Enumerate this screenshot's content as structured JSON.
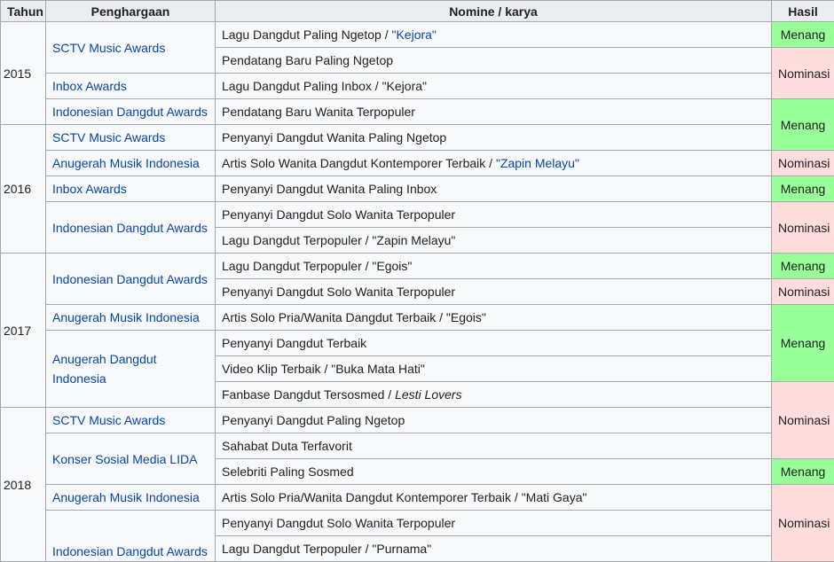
{
  "headers": {
    "year": "Tahun",
    "award": "Penghargaan",
    "nominee": "Nomine / karya",
    "result": "Hasil"
  },
  "colors": {
    "win": "#99ff99",
    "nominated": "#ffdddd",
    "link": "#0645ad",
    "header_bg": "#eaecf0",
    "border": "#a2a9b1"
  },
  "years": [
    "2015",
    "2016",
    "2017",
    "2018"
  ],
  "awards": {
    "sctv": "SCTV Music Awards",
    "inbox": "Inbox Awards",
    "ida": "Indonesian Dangdut Awards",
    "ami": "Anugerah Musik Indonesia",
    "adi": "Anugerah Dangdut Indonesia",
    "lida": "Konser Sosial Media LIDA"
  },
  "results": {
    "win": "Menang",
    "nom": "Nominasi"
  },
  "rows": {
    "r1": {
      "category": "Lagu Dangdut Paling Ngetop",
      "work": "\"Kejora\""
    },
    "r2": {
      "category": "Pendatang Baru Paling Ngetop"
    },
    "r3": {
      "category": "Lagu Dangdut Paling Inbox / \"Kejora\""
    },
    "r4": {
      "category": "Pendatang Baru Wanita Terpopuler"
    },
    "r5": {
      "category": "Penyanyi Dangdut Wanita Paling Ngetop"
    },
    "r6": {
      "category": "Artis Solo Wanita Dangdut Kontemporer Terbaik",
      "work": "\"Zapin Melayu\""
    },
    "r7": {
      "category": "Penyanyi Dangdut Wanita Paling Inbox"
    },
    "r8": {
      "category": "Penyanyi Dangdut Solo Wanita Terpopuler"
    },
    "r9": {
      "category": "Lagu Dangdut Terpopuler / \"Zapin Melayu\""
    },
    "r10": {
      "category": "Lagu Dangdut Terpopuler / \"Egois\""
    },
    "r11": {
      "category": "Penyanyi Dangdut Solo Wanita Terpopuler"
    },
    "r12": {
      "category": "Artis Solo Pria/Wanita Dangdut Terbaik / \"Egois\""
    },
    "r13": {
      "category": "Penyanyi Dangdut Terbaik"
    },
    "r14": {
      "category": "Video Klip Terbaik / \"Buka Mata Hati\""
    },
    "r15": {
      "category": "Fanbase Dangdut Tersosmed",
      "work": "Lesti Lovers"
    },
    "r16": {
      "category": "Penyanyi Dangdut Paling Ngetop"
    },
    "r17": {
      "category": "Sahabat Duta Terfavorit"
    },
    "r18": {
      "category": "Selebriti Paling Sosmed"
    },
    "r19": {
      "category": "Artis Solo Pria/Wanita Dangdut Kontemporer Terbaik / \"Mati Gaya\""
    },
    "r20": {
      "category": "Penyanyi Dangdut Solo Wanita Terpopuler"
    },
    "r21": {
      "category": "Lagu Dangdut Terpopuler / \"Purnama\""
    }
  },
  "separator": " / "
}
